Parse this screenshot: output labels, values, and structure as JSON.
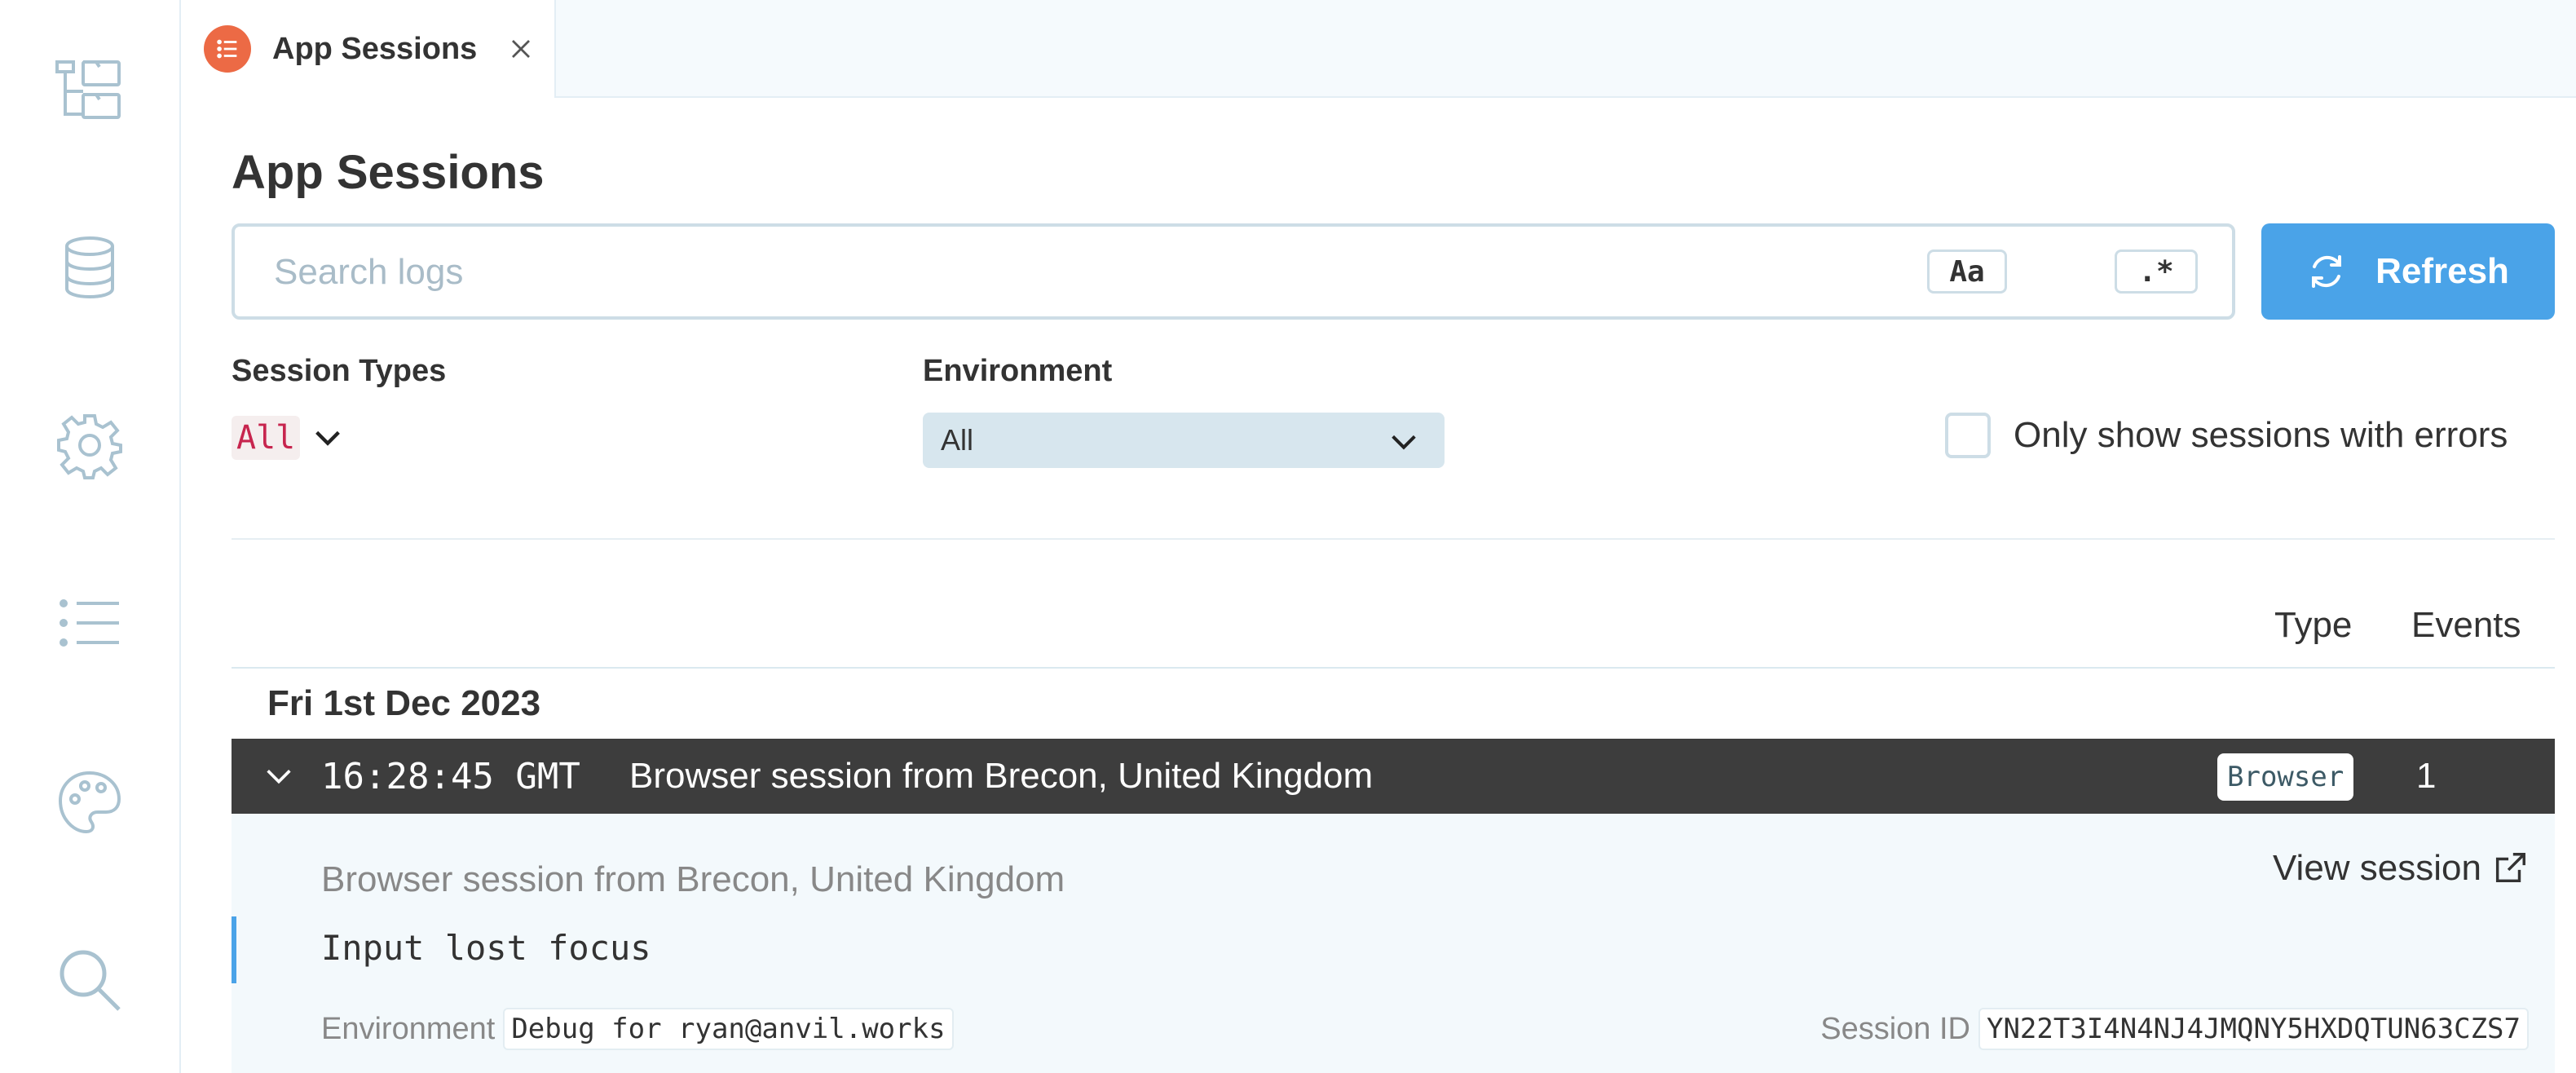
{
  "tab": {
    "label": "App Sessions",
    "icon": "list-icon",
    "close_icon": "close-icon"
  },
  "page": {
    "title": "App Sessions"
  },
  "search": {
    "placeholder": "Search logs",
    "value": "",
    "case_label": "Aa",
    "regex_label": ".*"
  },
  "refresh": {
    "label": "Refresh",
    "icon": "refresh-icon"
  },
  "filters": {
    "session_types_label": "Session Types",
    "session_types_value": "All",
    "environment_label": "Environment",
    "environment_value": "All",
    "errors_only_label": "Only show sessions with errors",
    "errors_only_checked": false
  },
  "table": {
    "columns": {
      "type": "Type",
      "events": "Events"
    },
    "groups": [
      {
        "date": "Fri 1st Dec 2023",
        "sessions": [
          {
            "time": "16:28:45 GMT",
            "description": "Browser session from Brecon, United Kingdom",
            "type": "Browser",
            "events": "1",
            "expanded": true,
            "detail": {
              "description": "Browser session from Brecon, United Kingdom",
              "view_label": "View session",
              "log_line": "Input lost focus",
              "environment_label": "Environment",
              "environment_value": "Debug for ryan@anvil.works",
              "session_id_label": "Session ID",
              "session_id_value": "YN22T3I4N4NJ4JMQNY5HXDQTUN63CZS7"
            }
          }
        ]
      }
    ]
  },
  "sidebar": {
    "items": [
      {
        "icon": "app-tree-icon"
      },
      {
        "icon": "database-icon"
      },
      {
        "icon": "settings-gear-icon"
      },
      {
        "icon": "list-icon"
      },
      {
        "icon": "palette-icon"
      },
      {
        "icon": "search-icon"
      }
    ]
  },
  "colors": {
    "accent": "#4aa3e8",
    "tab_icon": "#ec6a45",
    "row_bg": "#3d3d3d",
    "icon_stroke": "#a9c2d0"
  }
}
